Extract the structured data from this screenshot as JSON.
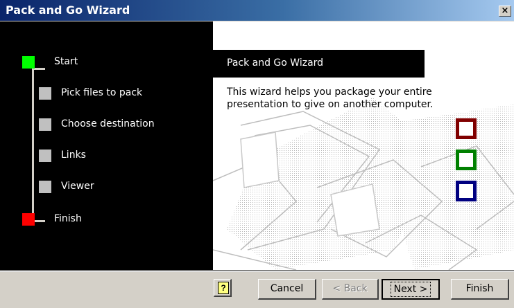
{
  "window": {
    "title": "Pack and Go Wizard",
    "close_glyph": "×"
  },
  "steps": [
    {
      "label": "Start",
      "color": "#00ff00"
    },
    {
      "label": "Pick files to pack",
      "color": "#c0c0c0"
    },
    {
      "label": "Choose destination",
      "color": "#c0c0c0"
    },
    {
      "label": "Links",
      "color": "#c0c0c0"
    },
    {
      "label": "Viewer",
      "color": "#c0c0c0"
    },
    {
      "label": "Finish",
      "color": "#ff0000"
    }
  ],
  "panel": {
    "heading": "Pack and Go Wizard",
    "description": "This wizard helps you package your entire presentation to give on another computer.",
    "squares": [
      "#800000",
      "#008000",
      "#000080"
    ]
  },
  "buttons": {
    "help": "?",
    "cancel": "Cancel",
    "back": "< Back",
    "next": "Next >",
    "finish": "Finish"
  }
}
